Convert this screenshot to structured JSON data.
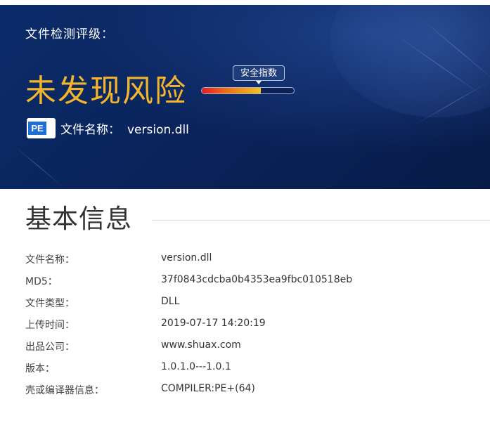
{
  "banner": {
    "level_label": "文件检测评级：",
    "risk_result": "未发现风险",
    "file_icon_text": "PE",
    "file_name_label": "文件名称：",
    "file_name_value": "version.dll",
    "gauge_label": "安全指数",
    "gauge_fraction": 0.64,
    "colors": {
      "risk_text": "#f5b52a",
      "banner_bg": "#0a2258"
    }
  },
  "basic_info": {
    "title": "基本信息",
    "rows": [
      {
        "key": "文件名称：",
        "value": "version.dll"
      },
      {
        "key": "MD5：",
        "value": "37f0843cdcba0b4353ea9fbc010518eb"
      },
      {
        "key": "文件类型：",
        "value": "DLL"
      },
      {
        "key": "上传时间：",
        "value": "2019-07-17 14:20:19"
      },
      {
        "key": "出品公司：",
        "value": "www.shuax.com"
      },
      {
        "key": "版本：",
        "value": "1.0.1.0---1.0.1"
      },
      {
        "key": "壳或编译器信息：",
        "value": "COMPILER:PE+(64)"
      }
    ]
  }
}
